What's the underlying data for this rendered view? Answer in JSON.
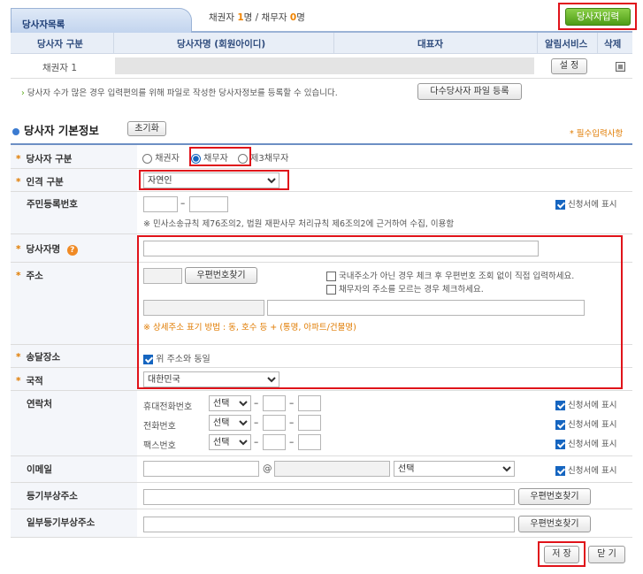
{
  "header": {
    "tab_label": "당사자목록",
    "creditor_label": "채권자",
    "creditor_count": "1",
    "debtor_label": "채무자",
    "debtor_count": "0",
    "unit": "명",
    "separator": "/",
    "add_button": "당사자입력"
  },
  "party_table": {
    "columns": [
      "당사자 구분",
      "당사자명 (회원아이디)",
      "대표자",
      "알림서비스",
      "삭제"
    ],
    "rows": [
      {
        "type": "채권자 1",
        "name": "",
        "representative": "",
        "alert_button": "설 정"
      }
    ]
  },
  "bulk_notice": {
    "text": "당사자 수가 많은 경우 입력편의를 위해 파일로 작성한 당사자정보를 등록할 수 있습니다.",
    "button": "다수당사자 파일 등록"
  },
  "section": {
    "title": "당사자 기본정보",
    "reset_button": "초기화",
    "required_note": "* 필수입력사항"
  },
  "form": {
    "party_type": {
      "label": "당사자 구분",
      "options": [
        "채권자",
        "채무자",
        "제3채무자"
      ],
      "selected": "채무자"
    },
    "person_type": {
      "label": "인격 구분",
      "value": "자연인"
    },
    "resident_no": {
      "label": "주민등록번호",
      "dash": "–",
      "show_label": "신청서에 표시",
      "notice": "※ 민사소송규칙 제76조의2, 법원 재판사무 처리규칙 제6조의2에 근거하여 수집, 이용함"
    },
    "party_name": {
      "label": "당사자명",
      "help_icon": "question-icon"
    },
    "address": {
      "label": "주소",
      "zip_button": "우편번호찾기",
      "check1": "국내주소가 아닌 경우 체크 후 우편번호 조회 없이 직접 입력하세요.",
      "check2": "채무자의 주소를 모르는 경우 체크하세요.",
      "hint": "※ 상세주소 표기 방법 : 동, 호수 등 + (통명, 아파트/건물명)"
    },
    "delivery": {
      "label": "송달장소",
      "same_label": "위 주소와 동일"
    },
    "nationality": {
      "label": "국적",
      "value": "대한민국"
    },
    "contact": {
      "label": "연락처",
      "rows": [
        {
          "label": "휴대전화번호",
          "select": "선택",
          "show_label": "신청서에 표시"
        },
        {
          "label": "전화번호",
          "select": "선택",
          "show_label": "신청서에 표시"
        },
        {
          "label": "팩스번호",
          "select": "선택",
          "show_label": "신청서에 표시"
        }
      ],
      "dash": "–"
    },
    "email": {
      "label": "이메일",
      "at": "@",
      "select": "선택",
      "show_label": "신청서에 표시"
    },
    "registry_address": {
      "label": "등기부상주소",
      "zip_button": "우편번호찾기"
    },
    "partial_registry_address": {
      "label": "일부등기부상주소",
      "zip_button": "우편번호찾기"
    }
  },
  "footer": {
    "save_button": "저 장",
    "close_button": "닫 기"
  },
  "colors": {
    "accent_blue": "#1565c0",
    "highlight_red": "#e0131a",
    "required_orange": "#e07b00",
    "count_orange": "#f08300",
    "add_green": "#5cab1b"
  }
}
